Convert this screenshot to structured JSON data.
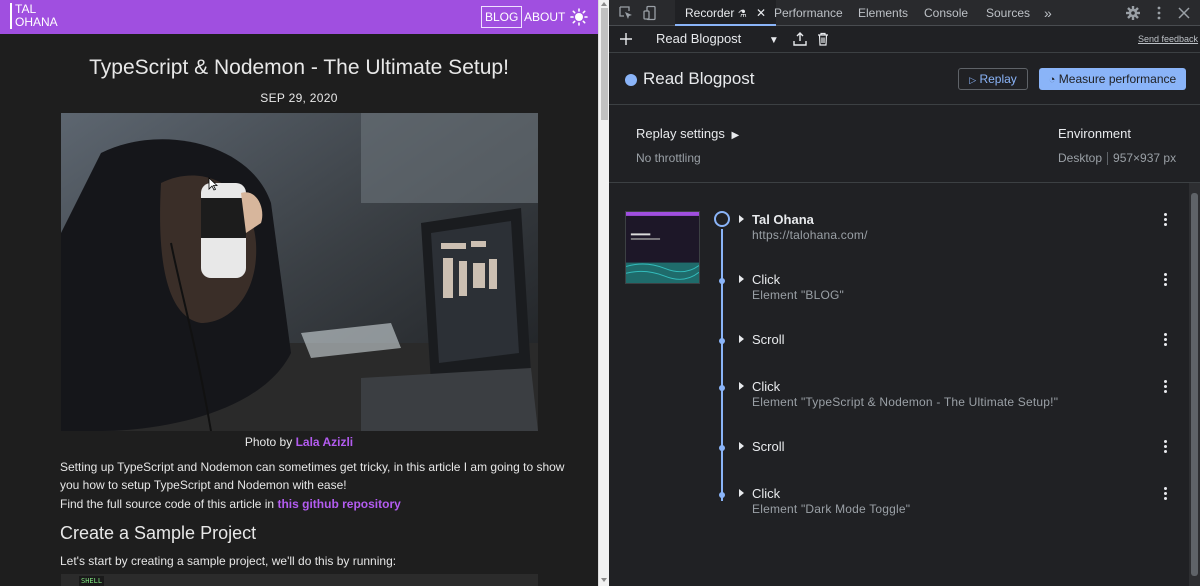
{
  "site": {
    "logo_line1": "TAL",
    "logo_line2": "OHANA",
    "nav_blog": "BLOG",
    "nav_about": "ABOUT",
    "post_title": "TypeScript & Nodemon - The Ultimate Setup!",
    "post_date": "SEP 29, 2020",
    "caption_prefix": "Photo by",
    "caption_author": "Lala Azizli",
    "para1": "Setting up TypeScript and Nodemon can sometimes get tricky, in this article I am going to show you how to setup TypeScript and Nodemon with ease!",
    "para2_prefix": "Find the full source code of this article in",
    "para2_link": "this github repository",
    "h2": "Create a Sample Project",
    "para3": "Let's start by creating a sample project, we'll do this by running:",
    "code_tag": "SHELL",
    "accent_color": "#a04fe0"
  },
  "devtools": {
    "tabs": [
      "Recorder",
      "Performance",
      "Elements",
      "Console",
      "Sources"
    ],
    "more_tabs": "»",
    "recording_select": "Read Blogpost",
    "send_feedback": "Send feedback",
    "recording_title": "Read Blogpost",
    "replay_button": "Replay",
    "measure_button": "Measure performance",
    "replay_settings_label": "Replay settings",
    "throttling": "No throttling",
    "environment_label": "Environment",
    "environment_device": "Desktop",
    "environment_size": "957×937 px",
    "steps": [
      {
        "title": "Tal Ohana",
        "subtitle": "https://talohana.com/"
      },
      {
        "title": "Click",
        "subtitle": "Element \"BLOG\""
      },
      {
        "title": "Scroll",
        "subtitle": ""
      },
      {
        "title": "Click",
        "subtitle": "Element \"TypeScript & Nodemon - The Ultimate Setup!\""
      },
      {
        "title": "Scroll",
        "subtitle": ""
      },
      {
        "title": "Click",
        "subtitle": "Element \"Dark Mode Toggle\""
      }
    ],
    "accent_color": "#8ab4f8"
  }
}
